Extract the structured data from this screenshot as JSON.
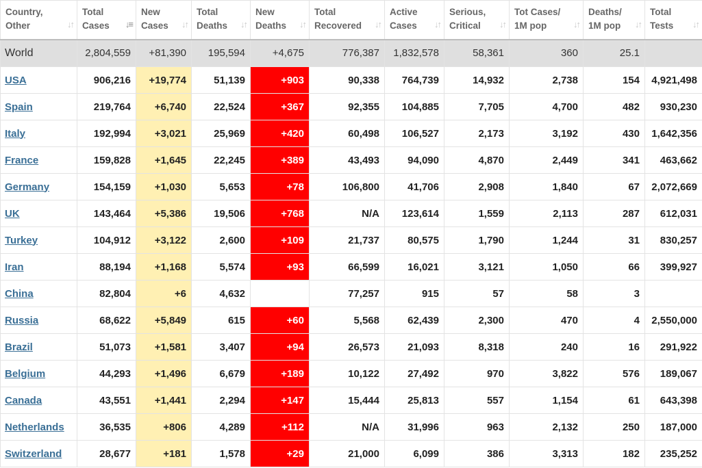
{
  "headers": [
    {
      "line1": "Country,",
      "line2": "Other"
    },
    {
      "line1": "Total",
      "line2": "Cases",
      "sorted": true
    },
    {
      "line1": "New",
      "line2": "Cases"
    },
    {
      "line1": "Total",
      "line2": "Deaths"
    },
    {
      "line1": "New",
      "line2": "Deaths"
    },
    {
      "line1": "Total",
      "line2": "Recovered"
    },
    {
      "line1": "Active",
      "line2": "Cases"
    },
    {
      "line1": "Serious,",
      "line2": "Critical"
    },
    {
      "line1": "Tot Cases/",
      "line2": "1M pop"
    },
    {
      "line1": "Deaths/",
      "line2": "1M pop"
    },
    {
      "line1": "Total",
      "line2": "Tests"
    }
  ],
  "world": [
    "World",
    "2,804,559",
    "+81,390",
    "195,594",
    "+4,675",
    "776,387",
    "1,832,578",
    "58,361",
    "360",
    "25.1",
    ""
  ],
  "rows": [
    [
      "USA",
      "906,216",
      "+19,774",
      "51,139",
      "+903",
      "90,338",
      "764,739",
      "14,932",
      "2,738",
      "154",
      "4,921,498"
    ],
    [
      "Spain",
      "219,764",
      "+6,740",
      "22,524",
      "+367",
      "92,355",
      "104,885",
      "7,705",
      "4,700",
      "482",
      "930,230"
    ],
    [
      "Italy",
      "192,994",
      "+3,021",
      "25,969",
      "+420",
      "60,498",
      "106,527",
      "2,173",
      "3,192",
      "430",
      "1,642,356"
    ],
    [
      "France",
      "159,828",
      "+1,645",
      "22,245",
      "+389",
      "43,493",
      "94,090",
      "4,870",
      "2,449",
      "341",
      "463,662"
    ],
    [
      "Germany",
      "154,159",
      "+1,030",
      "5,653",
      "+78",
      "106,800",
      "41,706",
      "2,908",
      "1,840",
      "67",
      "2,072,669"
    ],
    [
      "UK",
      "143,464",
      "+5,386",
      "19,506",
      "+768",
      "N/A",
      "123,614",
      "1,559",
      "2,113",
      "287",
      "612,031"
    ],
    [
      "Turkey",
      "104,912",
      "+3,122",
      "2,600",
      "+109",
      "21,737",
      "80,575",
      "1,790",
      "1,244",
      "31",
      "830,257"
    ],
    [
      "Iran",
      "88,194",
      "+1,168",
      "5,574",
      "+93",
      "66,599",
      "16,021",
      "3,121",
      "1,050",
      "66",
      "399,927"
    ],
    [
      "China",
      "82,804",
      "+6",
      "4,632",
      "",
      "77,257",
      "915",
      "57",
      "58",
      "3",
      ""
    ],
    [
      "Russia",
      "68,622",
      "+5,849",
      "615",
      "+60",
      "5,568",
      "62,439",
      "2,300",
      "470",
      "4",
      "2,550,000"
    ],
    [
      "Brazil",
      "51,073",
      "+1,581",
      "3,407",
      "+94",
      "26,573",
      "21,093",
      "8,318",
      "240",
      "16",
      "291,922"
    ],
    [
      "Belgium",
      "44,293",
      "+1,496",
      "6,679",
      "+189",
      "10,122",
      "27,492",
      "970",
      "3,822",
      "576",
      "189,067"
    ],
    [
      "Canada",
      "43,551",
      "+1,441",
      "2,294",
      "+147",
      "15,444",
      "25,813",
      "557",
      "1,154",
      "61",
      "643,398"
    ],
    [
      "Netherlands",
      "36,535",
      "+806",
      "4,289",
      "+112",
      "N/A",
      "31,996",
      "963",
      "2,132",
      "250",
      "187,000"
    ],
    [
      "Switzerland",
      "28,677",
      "+181",
      "1,578",
      "+29",
      "21,000",
      "6,099",
      "386",
      "3,313",
      "182",
      "235,252"
    ]
  ],
  "colors": {
    "new_cases_bg": "#fff0b3",
    "new_deaths_bg": "#ff0000",
    "world_bg": "#dfdfdf",
    "link": "#3a6f96"
  },
  "icons": {
    "sort": "sort-arrows-icon",
    "sort_active": "sort-descending-icon"
  }
}
